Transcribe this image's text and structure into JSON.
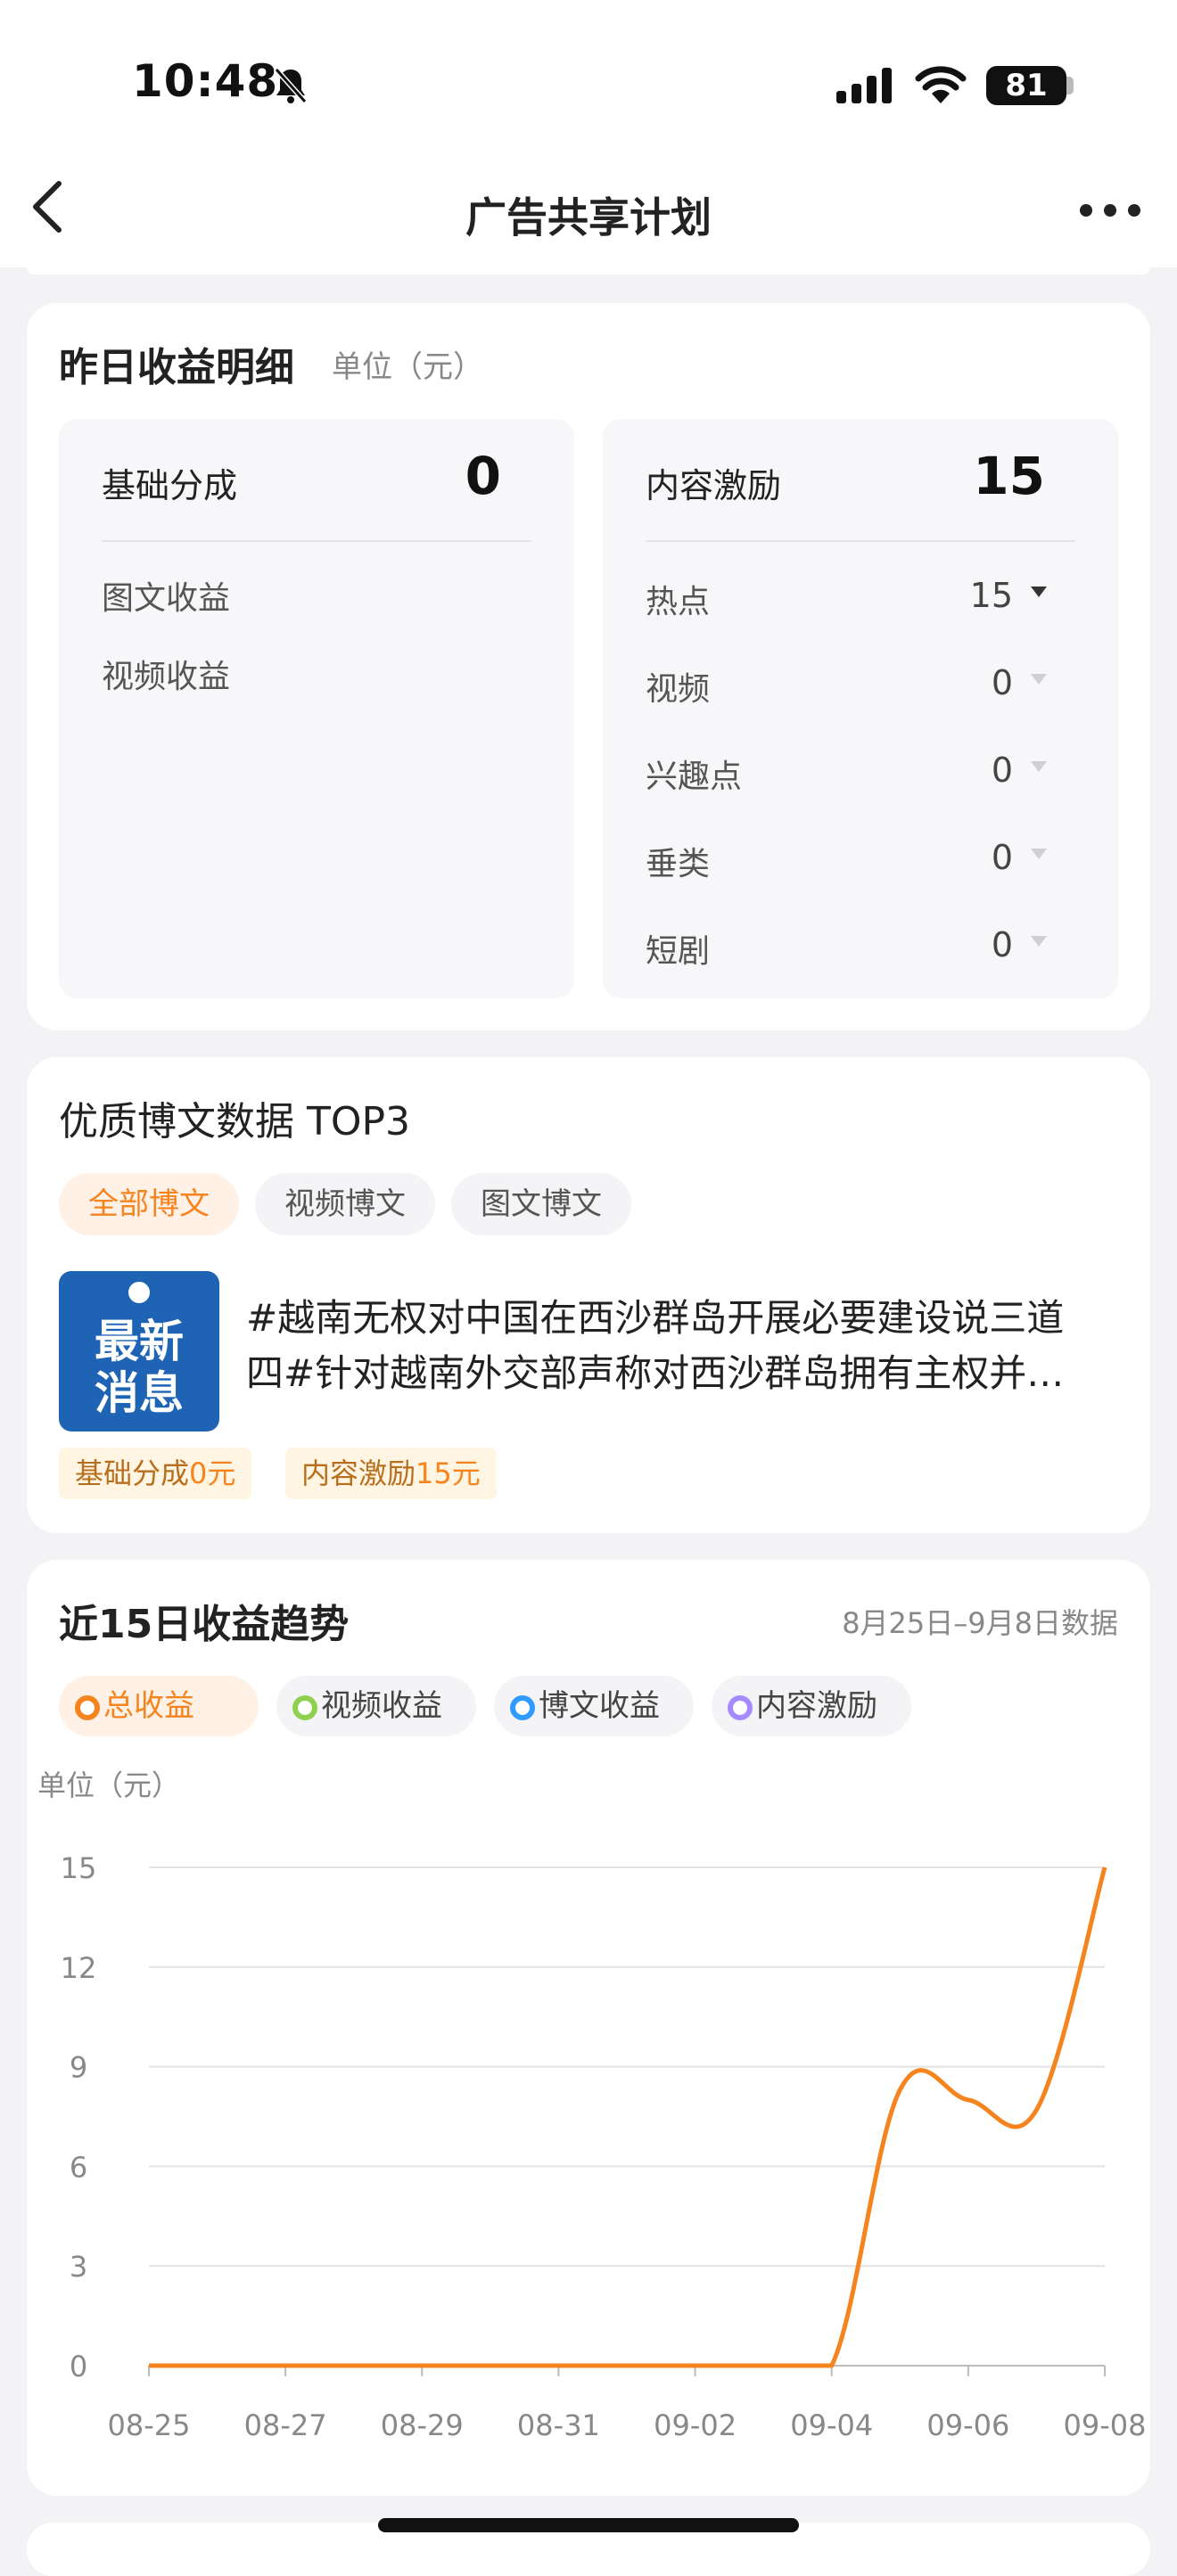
{
  "status_bar": {
    "time": "10:48",
    "battery": "81",
    "icons": [
      "bell-slash-icon",
      "signal-icon",
      "wifi-icon",
      "battery-icon"
    ]
  },
  "nav": {
    "title": "广告共享计划",
    "back_icon": "chevron-left-icon",
    "more_icon": "more-dots-icon"
  },
  "yesterday": {
    "title": "昨日收益明细",
    "unit": "单位（元）",
    "base": {
      "label": "基础分成",
      "value": "0",
      "rows": [
        "图文收益",
        "视频收益"
      ]
    },
    "incentive": {
      "label": "内容激励",
      "value": "15",
      "rows": [
        {
          "label": "热点",
          "value": "15"
        },
        {
          "label": "视频",
          "value": "0"
        },
        {
          "label": "兴趣点",
          "value": "0"
        },
        {
          "label": "垂类",
          "value": "0"
        },
        {
          "label": "短剧",
          "value": "0"
        }
      ]
    }
  },
  "top_posts": {
    "title": "优质博文数据 TOP3",
    "tabs": [
      "全部博文",
      "视频博文",
      "图文博文"
    ],
    "active_tab": "全部博文",
    "post": {
      "thumb_lines": [
        "最新",
        "消息"
      ],
      "line1": "#越南无权对中国在西沙群岛开展必要建设说三道",
      "line2": "四#针对越南外交部声称对西沙群岛拥有主权并…",
      "tag1_label": "基础分成",
      "tag1_value": "0元",
      "tag2_label": "内容激励",
      "tag2_value": "15元"
    }
  },
  "trend": {
    "title": "近15日收益趋势",
    "date_range": "8月25日–9月8日数据",
    "legend": [
      {
        "label": "总收益",
        "color": "#f5841f",
        "active": true
      },
      {
        "label": "视频收益",
        "color": "#8fd14f",
        "active": false
      },
      {
        "label": "博文收益",
        "color": "#2f9bff",
        "active": false
      },
      {
        "label": "内容激励",
        "color": "#a58bff",
        "active": false
      }
    ],
    "unit": "单位（元）"
  },
  "chart_data": {
    "type": "line",
    "title": "近15日收益趋势",
    "ylabel": "单位（元）",
    "ylim": [
      0,
      15
    ],
    "yticks": [
      0,
      3,
      6,
      9,
      12,
      15
    ],
    "x_tick_labels": [
      "08-25",
      "08-27",
      "08-29",
      "08-31",
      "09-02",
      "09-04",
      "09-06",
      "09-08"
    ],
    "x": [
      "08-25",
      "08-26",
      "08-27",
      "08-28",
      "08-29",
      "08-30",
      "08-31",
      "09-01",
      "09-02",
      "09-03",
      "09-04",
      "09-05",
      "09-06",
      "09-07",
      "09-08"
    ],
    "series": [
      {
        "name": "总收益",
        "color": "#f5841f",
        "values": [
          0,
          0,
          0,
          0,
          0,
          0,
          0,
          0,
          0,
          0,
          0,
          8.3,
          8.0,
          7.7,
          15
        ]
      }
    ],
    "grid": true
  }
}
